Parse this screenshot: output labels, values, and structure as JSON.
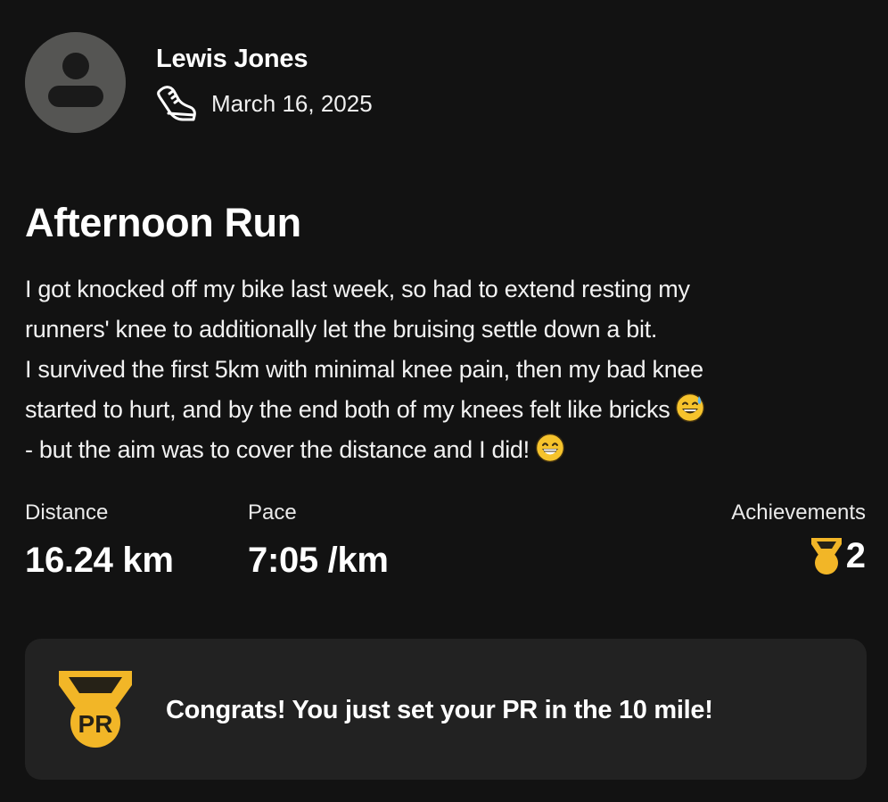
{
  "athlete": {
    "name": "Lewis Jones",
    "avatar_icon": "user-silhouette-icon"
  },
  "activity": {
    "sport_icon": "running-shoe-icon",
    "date": "March 16, 2025",
    "title": "Afternoon Run",
    "description_lines": [
      "I got knocked off my bike last week, so had to extend resting my",
      "runners' knee to additionally let the bruising settle down a bit.",
      "I survived the first 5km with minimal knee pain, then my bad knee",
      "started to hurt, and by the end both of my knees felt like bricks",
      "- but the aim was to cover the distance and I did!"
    ],
    "emojis": [
      "grinning-sweat-emoji",
      "beaming-smile-emoji"
    ]
  },
  "stats": {
    "distance": {
      "label": "Distance",
      "value": "16.24 km"
    },
    "pace": {
      "label": "Pace",
      "value": "7:05 /km"
    },
    "achievements": {
      "label": "Achievements",
      "value": "2",
      "icon": "medal-icon"
    }
  },
  "pr_card": {
    "badge_text": "PR",
    "badge_icon": "pr-medal-icon",
    "message": "Congrats! You just set your PR in the 10 mile!"
  },
  "colors": {
    "background": "#121212",
    "card": "#222222",
    "avatar": "#555553",
    "medal_gold": "#f2b627",
    "medal_dark": "#262217"
  }
}
